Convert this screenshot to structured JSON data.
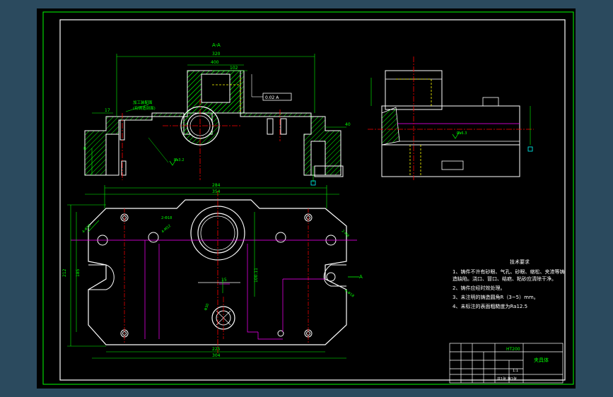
{
  "section_label": "A-A",
  "dims": {
    "top_width": "320",
    "top_w2": "400",
    "top_w3": "102",
    "lv1": "17",
    "lv2": "8",
    "lv3": "40",
    "plan_w1": "284",
    "plan_w2": "354",
    "plan_w3": "225",
    "plan_w4": "304",
    "plan_h1": "212",
    "plan_h2": "185",
    "plan_h3": "100.11",
    "plan_h4": "15"
  },
  "callouts": {
    "weld": "加工装配面",
    "weld2": "(有铸造剖面)",
    "tol": "0.02 A",
    "rough1": "Ra3.2",
    "rough2": "Ra6.3",
    "hole1": "4-Φ18",
    "hole2": "2-Φ18",
    "hole3": "Φ30",
    "hole4": "4-M12",
    "hole5": "2-M8",
    "datum": "A"
  },
  "tech_notes": {
    "title": "技术要求",
    "lines": [
      "1、铸件不许有砂眼、气孔、砂眼、缩松、夹渣等铸造缺陷。浇口、冒口、结疤、粘砂应清除干净。",
      "2、铸件应经时效处理。",
      "3、未注明的铸造圆角R（3~5）mm。",
      "4、未标注的表面粗糙度为Ra12.5"
    ]
  },
  "title_block": {
    "material": "HT200",
    "name": "夹具体",
    "sheet_info": "共1张  第1张",
    "scale": "1:1"
  },
  "colors": {
    "sheet_bg": "#000000",
    "frame": "#00ff00",
    "outline": "#ffffff",
    "hatch": "#00ff00",
    "center": "#ff0000",
    "hidden": "#ffff00",
    "aux": "#ff00ff"
  }
}
